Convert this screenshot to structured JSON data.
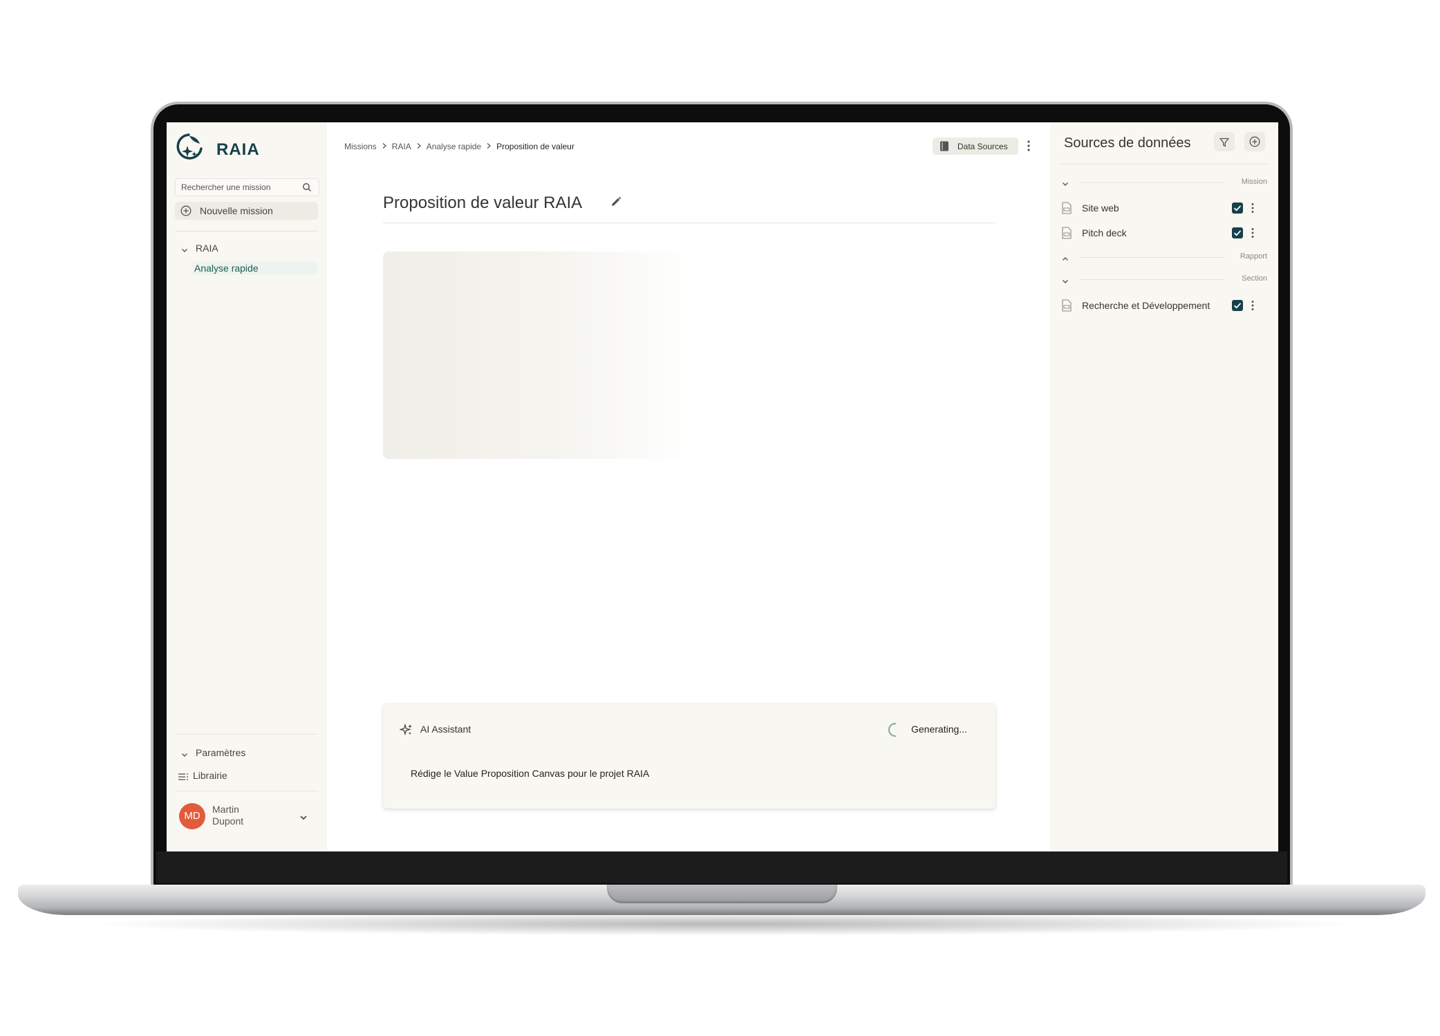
{
  "app": {
    "name": "RAIA"
  },
  "sidebar": {
    "search_placeholder": "Rechercher une mission",
    "new_mission_label": "Nouvelle mission",
    "tree": {
      "root_label": "RAIA",
      "child_label": "Analyse rapide"
    },
    "settings_label": "Paramètres",
    "library_label": "Librairie",
    "user": {
      "initials": "MD",
      "first_name": "Martin",
      "last_name": "Dupont"
    }
  },
  "breadcrumb": [
    "Missions",
    "RAIA",
    "Analyse rapide",
    "Proposition de valeur"
  ],
  "toolbar": {
    "data_sources_label": "Data Sources"
  },
  "main": {
    "title": "Proposition de valeur RAIA",
    "assistant": {
      "title": "AI Assistant",
      "status": "Generating...",
      "prompt": "Rédige le Value Proposition Canvas pour le projet RAIA"
    }
  },
  "data_sources": {
    "title": "Sources de données",
    "groups": {
      "mission": "Mission",
      "rapport": "Rapport",
      "section": "Section"
    },
    "items": [
      {
        "label": "Site web",
        "checked": true
      },
      {
        "label": "Pitch deck",
        "checked": true
      },
      {
        "label": "Recherche et Développement",
        "checked": true
      }
    ]
  },
  "colors": {
    "brand": "#17404a",
    "accent": "#1e5b52",
    "avatar": "#e15b3c",
    "sidebar_bg": "#f8f7f2"
  },
  "icons": [
    "raia-logo-icon",
    "search-icon",
    "plus-circle-icon",
    "chevron-down-icon",
    "chevron-up-icon",
    "chevron-right-icon",
    "list-icon",
    "book-icon",
    "more-vertical-icon",
    "pencil-icon",
    "sparkles-icon",
    "spinner-icon",
    "filter-icon",
    "document-icon",
    "checkbox-checked-icon"
  ]
}
